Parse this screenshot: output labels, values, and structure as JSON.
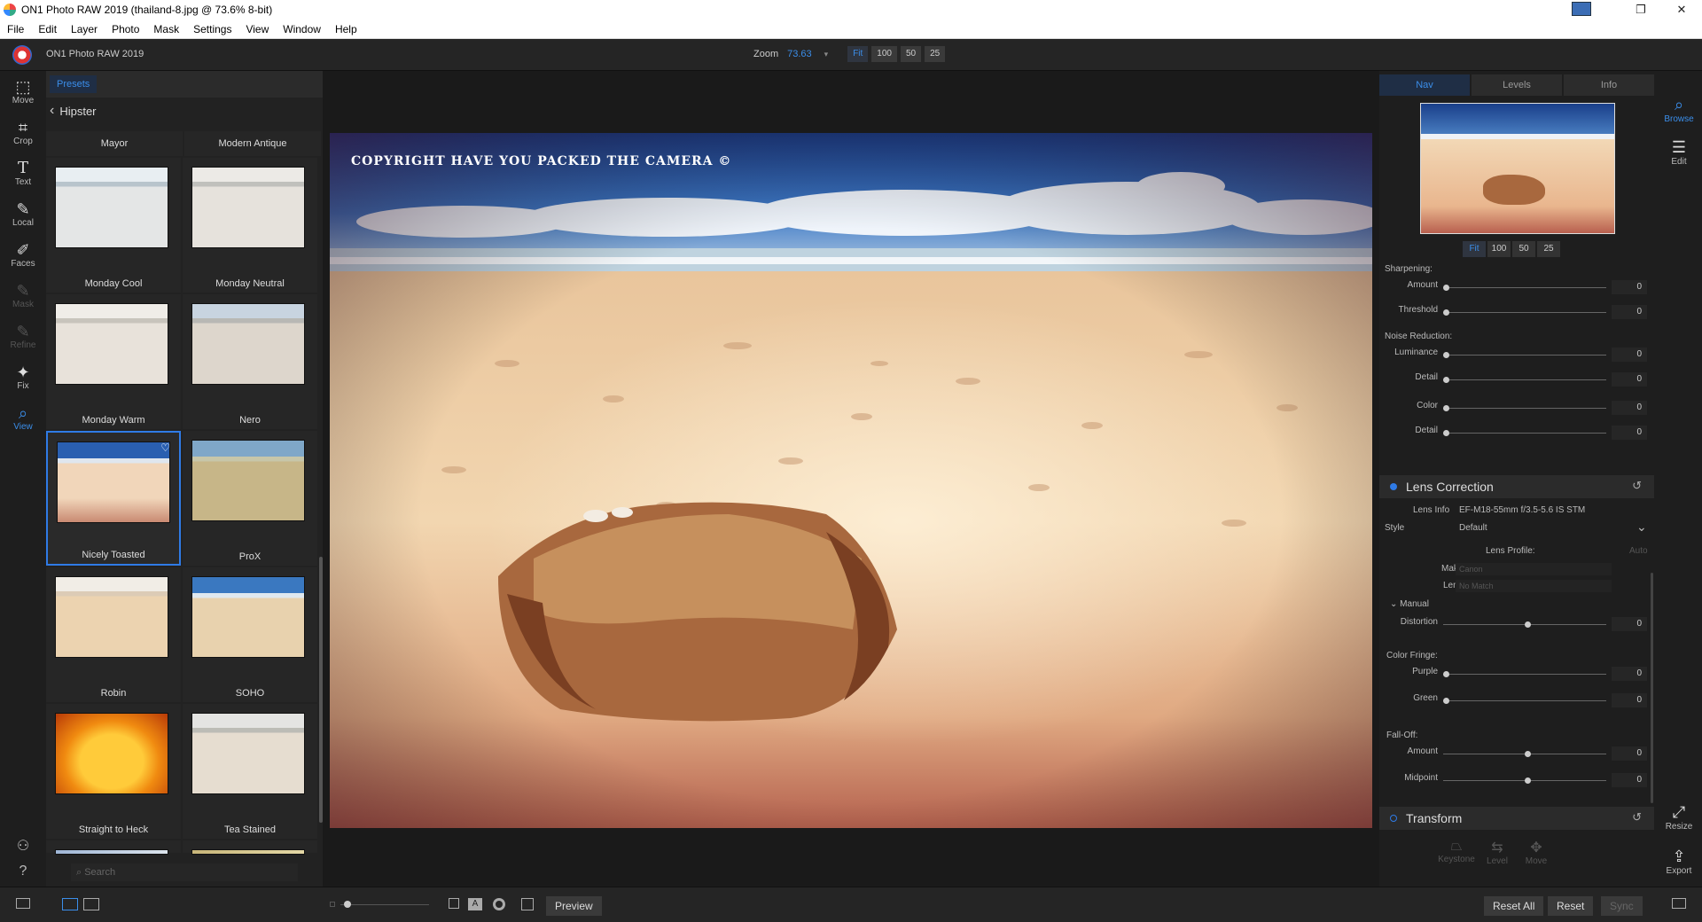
{
  "window": {
    "title": "ON1 Photo RAW 2019 (thailand-8.jpg @ 73.6% 8-bit)"
  },
  "menu": [
    "File",
    "Edit",
    "Layer",
    "Photo",
    "Mask",
    "Settings",
    "View",
    "Window",
    "Help"
  ],
  "header": {
    "app_name": "ON1 Photo RAW 2019",
    "zoom_label": "Zoom",
    "zoom_value": "73.63",
    "zoom_buttons": [
      "Fit",
      "100",
      "50",
      "25"
    ]
  },
  "left_tools": [
    {
      "label": "Move",
      "icon": "marquee-icon"
    },
    {
      "label": "Crop",
      "icon": "crop-icon"
    },
    {
      "label": "Text",
      "icon": "text-icon"
    },
    {
      "label": "Local",
      "icon": "brush-icon"
    },
    {
      "label": "Faces",
      "icon": "faces-icon"
    },
    {
      "label": "Mask",
      "icon": "mask-brush-icon"
    },
    {
      "label": "Refine",
      "icon": "refine-brush-icon"
    },
    {
      "label": "Fix",
      "icon": "fix-icon"
    },
    {
      "label": "View",
      "icon": "magnifier-icon"
    }
  ],
  "presets": {
    "tab": "Presets",
    "category": "Hipster",
    "columns_header": [
      "Mayor",
      "Modern Antique"
    ],
    "items": [
      "Monday Cool",
      "Monday Neutral",
      "Monday Warm",
      "Nero",
      "Nicely Toasted",
      "ProX",
      "Robin",
      "SOHO",
      "Straight to Heck",
      "Tea Stained"
    ],
    "selected": "Nicely Toasted",
    "search_placeholder": "Search"
  },
  "photo": {
    "watermark": "COPYRIGHT HAVE YOU PACKED THE CAMERA ©"
  },
  "right_panel": {
    "tabs": [
      "Nav",
      "Levels",
      "Info"
    ],
    "active_tab": "Nav",
    "nav_zoom": [
      "Fit",
      "100",
      "50",
      "25"
    ],
    "sharpening": {
      "label": "Sharpening:",
      "rows": [
        {
          "label": "Amount",
          "value": "0"
        },
        {
          "label": "Threshold",
          "value": "0"
        }
      ]
    },
    "noise": {
      "label": "Noise Reduction:",
      "rows": [
        {
          "label": "Luminance",
          "value": "0"
        },
        {
          "label": "Detail",
          "value": "0"
        },
        {
          "label": "Color",
          "value": "0"
        },
        {
          "label": "Detail",
          "value": "0"
        }
      ]
    },
    "lens": {
      "title": "Lens Correction",
      "lens_info_label": "Lens Info",
      "lens_info_value": "EF-M18-55mm f/3.5-5.6 IS STM",
      "style_label": "Style",
      "style_value": "Default",
      "profile_label": "Lens Profile:",
      "auto_label": "Auto",
      "make_label": "Make",
      "make_value": "Canon",
      "lens_label": "Lens",
      "lens_value": "No Match",
      "manual_label": "Manual",
      "distortion": {
        "label": "Distortion",
        "value": "0"
      },
      "fringe_label": "Color Fringe:",
      "purple": {
        "label": "Purple",
        "value": "0"
      },
      "green": {
        "label": "Green",
        "value": "0"
      },
      "falloff_label": "Fall-Off:",
      "amount": {
        "label": "Amount",
        "value": "0"
      },
      "midpoint": {
        "label": "Midpoint",
        "value": "0"
      }
    },
    "transform": {
      "title": "Transform",
      "tools": [
        "Keystone",
        "Level",
        "Move"
      ]
    }
  },
  "right_tools": [
    {
      "label": "Browse",
      "icon": "browse-icon"
    },
    {
      "label": "Edit",
      "icon": "sliders-icon"
    },
    {
      "label": "Resize",
      "icon": "resize-icon"
    },
    {
      "label": "Export",
      "icon": "export-icon"
    }
  ],
  "bottom": {
    "preview_label": "Preview",
    "reset_all": "Reset All",
    "reset": "Reset",
    "sync": "Sync"
  }
}
